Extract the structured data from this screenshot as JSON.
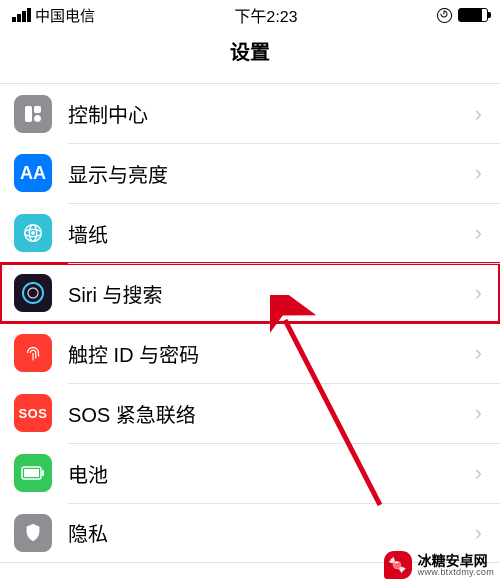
{
  "status": {
    "carrier": "中国电信",
    "time": "下午2:23"
  },
  "page": {
    "title": "设置"
  },
  "rows": [
    {
      "key": "control-center",
      "label": "控制中心",
      "icon_color": "bg-gray"
    },
    {
      "key": "display",
      "label": "显示与亮度",
      "icon_color": "bg-blue"
    },
    {
      "key": "wallpaper",
      "label": "墙纸",
      "icon_color": "bg-cyan"
    },
    {
      "key": "siri",
      "label": "Siri 与搜索",
      "icon_color": "bg-dark",
      "highlight": true
    },
    {
      "key": "touchid",
      "label": "触控 ID 与密码",
      "icon_color": "bg-red"
    },
    {
      "key": "sos",
      "label": "SOS 紧急联络",
      "icon_color": "bg-red2"
    },
    {
      "key": "battery",
      "label": "电池",
      "icon_color": "bg-green"
    },
    {
      "key": "privacy",
      "label": "隐私",
      "icon_color": "bg-gray2"
    }
  ],
  "watermark": {
    "brand": "冰糖安卓网",
    "domain": "www.btxtdmy.com"
  },
  "annotations": {
    "highlight_color": "#d9001b",
    "arrow_color": "#d9001b"
  }
}
